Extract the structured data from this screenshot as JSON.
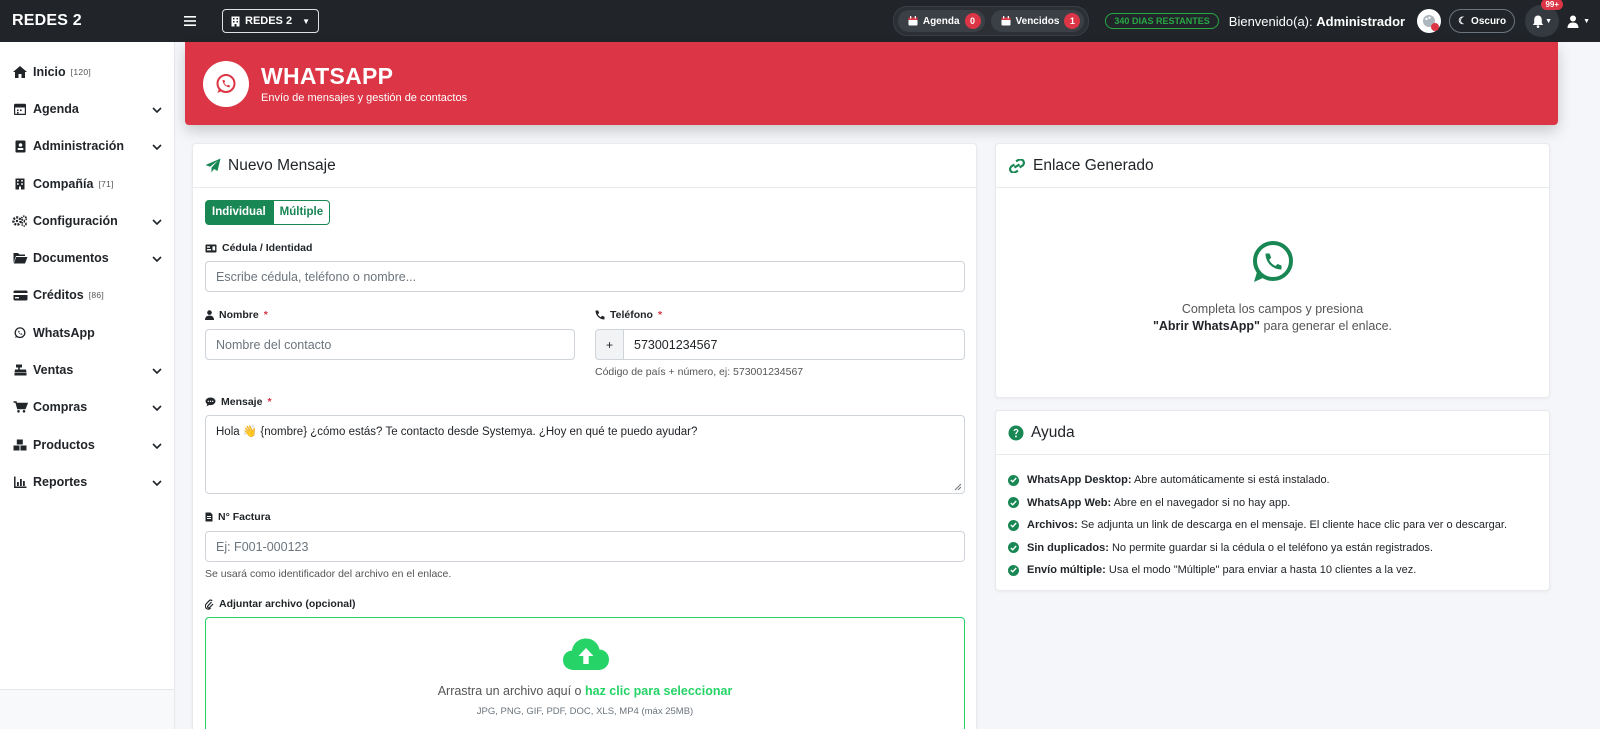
{
  "topbar": {
    "brand": "REDES 2",
    "company": "REDES 2",
    "pills": [
      {
        "label": "Agenda",
        "count": "0"
      },
      {
        "label": "Vencidos",
        "count": "1"
      }
    ],
    "days_left": "340 DIAS RESTANTES",
    "welcome_prefix": "Bienvenido(a):",
    "welcome_user": "Administrador",
    "theme_label": "Oscuro",
    "notif_count": "99+"
  },
  "sidebar": {
    "items": [
      {
        "label": "Inicio",
        "count": "[120]",
        "icon": "home-icon"
      },
      {
        "label": "Agenda",
        "icon": "calendar-icon"
      },
      {
        "label": "Administración",
        "icon": "id-card-icon"
      },
      {
        "label": "Compañía",
        "count": "[71]",
        "icon": "building-icon"
      },
      {
        "label": "Configuración",
        "icon": "gears-icon"
      },
      {
        "label": "Documentos",
        "icon": "folder-icon"
      },
      {
        "label": "Créditos",
        "count": "[86]",
        "icon": "credit-card-icon"
      },
      {
        "label": "WhatsApp",
        "icon": "whatsapp-icon"
      },
      {
        "label": "Ventas",
        "icon": "cash-register-icon"
      },
      {
        "label": "Compras",
        "icon": "cart-icon"
      },
      {
        "label": "Productos",
        "icon": "boxes-icon"
      },
      {
        "label": "Reportes",
        "icon": "chart-icon"
      }
    ]
  },
  "banner": {
    "title": "WHATSAPP",
    "subtitle": "Envío de mensajes y gestión de contactos"
  },
  "new_message": {
    "title": "Nuevo Mensaje",
    "mode_individual": "Individual",
    "mode_multiple": "Múltiple",
    "id_label": "Cédula / Identidad",
    "id_placeholder": "Escribe cédula, teléfono o nombre...",
    "name_label": "Nombre",
    "name_placeholder": "Nombre del contacto",
    "phone_label": "Teléfono",
    "phone_prefix": "+",
    "phone_value": "573001234567",
    "phone_hint": "Código de país + número, ej: 573001234567",
    "required_mark": "*",
    "message_label": "Mensaje",
    "message_value": "Hola 👋 {nombre} ¿cómo estás? Te contacto desde Systemya. ¿Hoy en qué te puedo ayudar?",
    "invoice_label": "N° Factura",
    "invoice_placeholder": "Ej: F001-000123",
    "invoice_hint": "Se usará como identificador del archivo en el enlace.",
    "attach_label": "Adjuntar archivo (opcional)",
    "drop_text": "Arrastra un archivo aquí o",
    "drop_link": "haz clic para seleccionar",
    "drop_types": "JPG, PNG, GIF, PDF, DOC, XLS, MP4 (máx 25MB)"
  },
  "link_card": {
    "title": "Enlace Generado",
    "line1": "Completa los campos y presiona",
    "line2_bold": "\"Abrir WhatsApp\"",
    "line2_rest": "para generar el enlace."
  },
  "help_card": {
    "title": "Ayuda",
    "items": [
      {
        "bold": "WhatsApp Desktop:",
        "text": "Abre automáticamente si está instalado."
      },
      {
        "bold": "WhatsApp Web:",
        "text": "Abre en el navegador si no hay app."
      },
      {
        "bold": "Archivos:",
        "text": "Se adjunta un link de descarga en el mensaje. El cliente hace clic para ver o descargar."
      },
      {
        "bold": "Sin duplicados:",
        "text": "No permite guardar si la cédula o el teléfono ya están registrados."
      },
      {
        "bold": "Envío múltiple:",
        "text": "Usa el modo \"Múltiple\" para enviar a hasta 10 clientes a la vez."
      }
    ]
  },
  "colors": {
    "danger": "#dc3545",
    "success": "#198754",
    "whatsapp": "#25d366",
    "dark": "#212529"
  }
}
